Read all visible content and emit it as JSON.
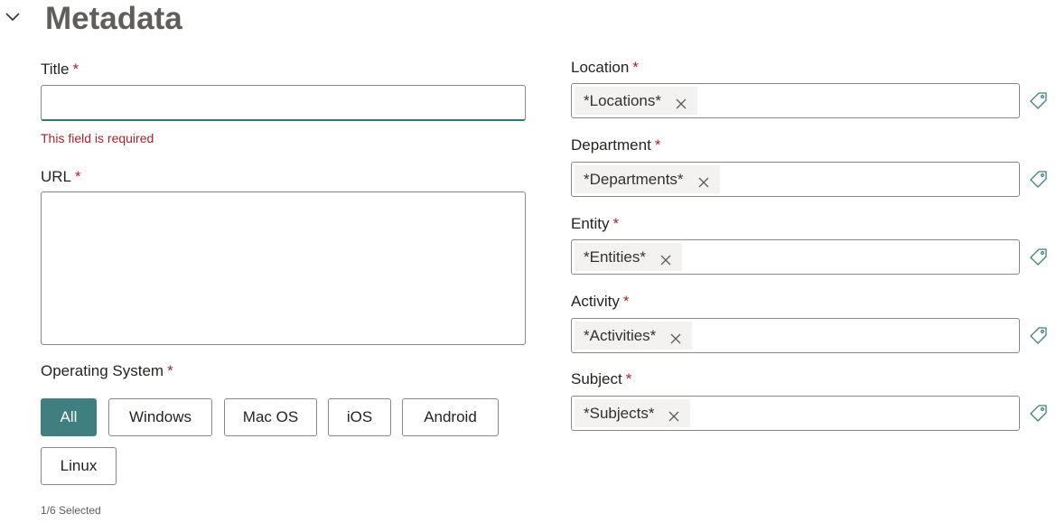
{
  "header": {
    "title": "Metadata",
    "collapse_icon": "chevron-down-icon"
  },
  "left": {
    "title_field": {
      "label": "Title",
      "required_mark": "*",
      "value": "",
      "error": "This field is required"
    },
    "url_field": {
      "label": "URL",
      "required_mark": "*",
      "value": ""
    },
    "os_field": {
      "label": "Operating System",
      "required_mark": "*",
      "options": [
        "All",
        "Windows",
        "Mac OS",
        "iOS",
        "Android",
        "Linux"
      ],
      "selected": "All",
      "status": "1/6 Selected"
    }
  },
  "right": {
    "fields": [
      {
        "label": "Location",
        "required_mark": "*",
        "tag": "*Locations*"
      },
      {
        "label": "Department",
        "required_mark": "*",
        "tag": "*Departments*"
      },
      {
        "label": "Entity",
        "required_mark": "*",
        "tag": "*Entities*"
      },
      {
        "label": "Activity",
        "required_mark": "*",
        "tag": "*Activities*"
      },
      {
        "label": "Subject",
        "required_mark": "*",
        "tag": "*Subjects*"
      }
    ]
  },
  "colors": {
    "accent": "#3f7f80",
    "error": "#a4262c",
    "pill_bg": "#f3f2f1",
    "border": "#8a8886"
  }
}
